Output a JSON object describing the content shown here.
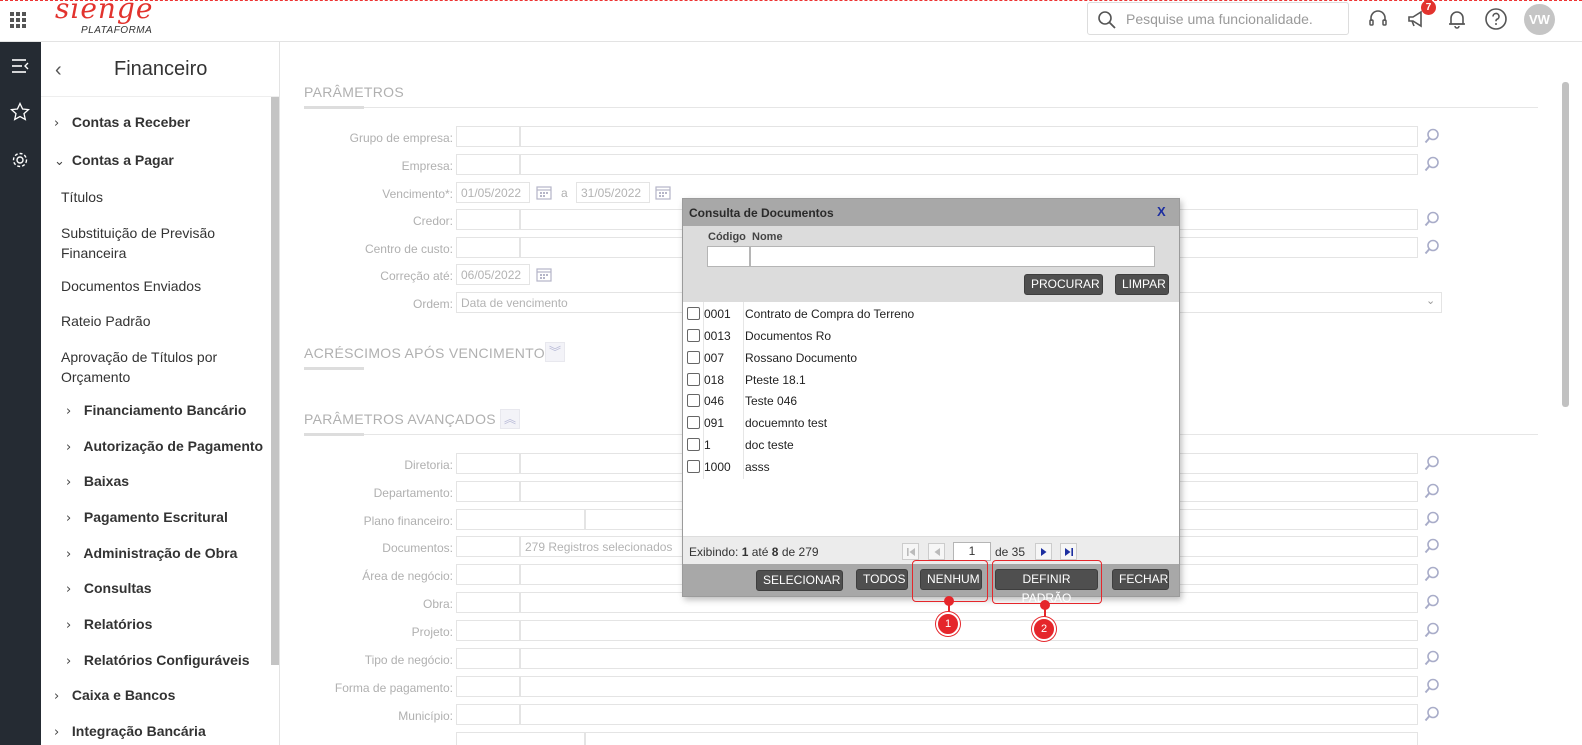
{
  "topbar": {
    "logo_word": "sienge",
    "logo_sub": "PLATAFORMA",
    "search_placeholder": "Pesquise uma funcionalidade.",
    "notifications_count": "7",
    "avatar_initials": "VW"
  },
  "sidebar": {
    "title": "Financeiro",
    "items": [
      {
        "label": "Contas a Receber",
        "chevron": "›"
      },
      {
        "label": "Contas a Pagar",
        "chevron": "⌄"
      },
      {
        "label": "Títulos"
      },
      {
        "label": "Substituição de Previsão Financeira"
      },
      {
        "label": "Documentos Enviados"
      },
      {
        "label": "Rateio Padrão"
      },
      {
        "label": "Aprovação de Títulos por Orçamento"
      },
      {
        "label": "Financiamento Bancário",
        "chevron": "›"
      },
      {
        "label": "Autorização de Pagamento",
        "chevron": "›"
      },
      {
        "label": "Baixas",
        "chevron": "›"
      },
      {
        "label": "Pagamento Escritural",
        "chevron": "›"
      },
      {
        "label": "Administração de Obra",
        "chevron": "›"
      },
      {
        "label": "Consultas",
        "chevron": "›"
      },
      {
        "label": "Relatórios",
        "chevron": "›"
      },
      {
        "label": "Relatórios Configuráveis",
        "chevron": "›"
      },
      {
        "label": "Caixa e Bancos",
        "chevron": "›"
      },
      {
        "label": "Integração Bancária",
        "chevron": "›"
      }
    ]
  },
  "main": {
    "sections": {
      "parametros": "PARÂMETROS",
      "acrescimos": "ACRÉSCIMOS APÓS VENCIMENTO",
      "avancados": "PARÂMETROS AVANÇADOS"
    },
    "fields": {
      "grupo_empresa": "Grupo de empresa:",
      "empresa": "Empresa:",
      "vencimento": "Vencimento*:",
      "venc_de": "01/05/2022",
      "venc_a_label": "a",
      "venc_ate": "31/05/2022",
      "credor": "Credor:",
      "centro_custo": "Centro de custo:",
      "correcao": "Correção até:",
      "correcao_val": "06/05/2022",
      "ordem": "Ordem:",
      "ordem_val": "Data de vencimento",
      "diretoria": "Diretoria:",
      "departamento": "Departamento:",
      "plano": "Plano financeiro:",
      "documentos": "Documentos:",
      "documentos_val": "279 Registros selecionados",
      "area": "Área de negócio:",
      "obra": "Obra:",
      "projeto": "Projeto:",
      "tipo": "Tipo de negócio:",
      "forma": "Forma de pagamento:",
      "municipio": "Município:"
    }
  },
  "modal": {
    "title": "Consulta de Documentos",
    "close": "X",
    "col_codigo": "Código",
    "col_nome": "Nome",
    "btn_procurar": "PROCURAR",
    "btn_limpar": "LIMPAR",
    "rows": [
      {
        "code": "0001",
        "name": "Contrato de Compra do Terreno"
      },
      {
        "code": "0013",
        "name": "Documentos Ro"
      },
      {
        "code": "007",
        "name": "Rossano Documento"
      },
      {
        "code": "018",
        "name": "Pteste 18.1"
      },
      {
        "code": "046",
        "name": "Teste 046"
      },
      {
        "code": "091",
        "name": "docuemnto test"
      },
      {
        "code": "1",
        "name": "doc teste"
      },
      {
        "code": "1000",
        "name": "asss"
      }
    ],
    "pager": {
      "exibindo": "Exibindo:",
      "from": "1",
      "ate": "até",
      "to": "8",
      "de": "de",
      "total": "279",
      "page": "1",
      "of_pages": "de 35"
    },
    "buttons": {
      "selecionar": "SELECIONAR",
      "todos": "TODOS",
      "nenhum": "NENHUM",
      "definir": "DEFINIR PADRÃO",
      "fechar": "FECHAR"
    }
  },
  "annotations": {
    "marker1": "1",
    "marker2": "2",
    "color": "#e5262b"
  },
  "colors": {
    "brand": "#e2332e",
    "rail": "#252b33"
  }
}
